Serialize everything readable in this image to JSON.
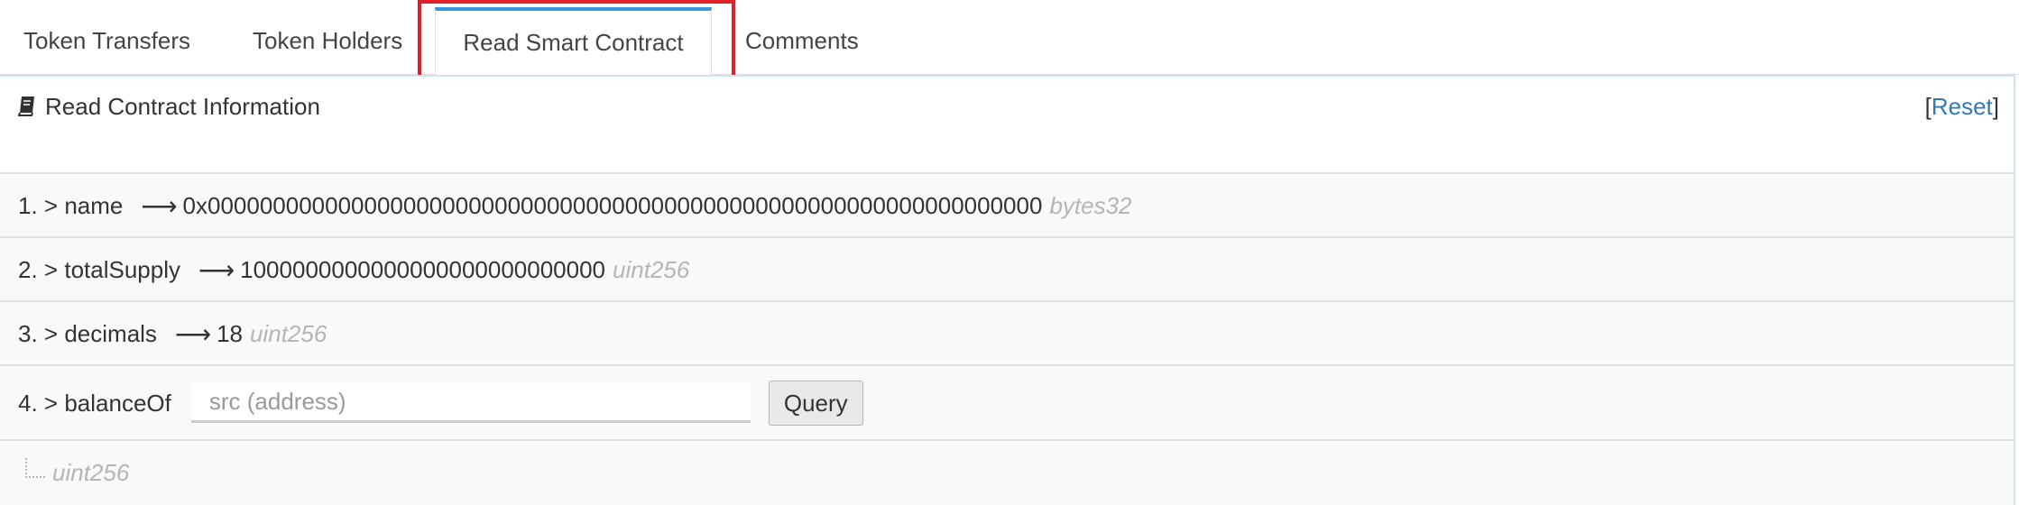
{
  "tabs": [
    {
      "label": "Token Transfers"
    },
    {
      "label": "Token Holders"
    },
    {
      "label": "Read Smart Contract"
    },
    {
      "label": "Comments"
    }
  ],
  "panel": {
    "title": "Read Contract Information",
    "reset_open": "[",
    "reset_label": "Reset",
    "reset_close": "]"
  },
  "rows": [
    {
      "index": "1.",
      "chevron": ">",
      "name": "name",
      "arrow": "⟶",
      "value": "0x0000000000000000000000000000000000000000000000000000000000000000",
      "type": "bytes32"
    },
    {
      "index": "2.",
      "chevron": ">",
      "name": "totalSupply",
      "arrow": "⟶",
      "value": "1000000000000000000000000000",
      "type": "uint256"
    },
    {
      "index": "3.",
      "chevron": ">",
      "name": "decimals",
      "arrow": "⟶",
      "value": "18",
      "type": "uint256"
    },
    {
      "index": "4.",
      "chevron": ">",
      "name": "balanceOf",
      "input_placeholder": "src (address)",
      "button_label": "Query",
      "result_type": "uint256"
    }
  ],
  "colors": {
    "accent": "#3498db",
    "link": "#3479b7",
    "highlight": "#e0202a",
    "type_text": "#b5b5b5"
  }
}
